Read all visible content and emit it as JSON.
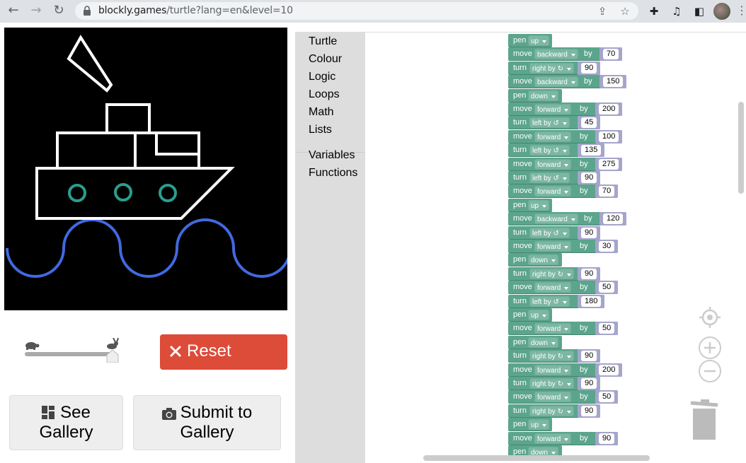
{
  "browser": {
    "url_host": "blockly.games",
    "url_path": "/turtle?lang=en&level=10"
  },
  "speed": {
    "value": 1.0
  },
  "buttons": {
    "reset": "Reset",
    "see_gallery_line1": "See",
    "see_gallery_line2": "Gallery",
    "submit_line1": "Submit to",
    "submit_line2": "Gallery"
  },
  "toolbox": {
    "categories": [
      "Turtle",
      "Colour",
      "Logic",
      "Loops",
      "Math",
      "Lists"
    ],
    "categories2": [
      "Variables",
      "Functions"
    ]
  },
  "colors": {
    "block": "#5ba58c",
    "math_block": "#a5a5cc",
    "reset": "#dd4b39",
    "wave": "#4169e1",
    "portholes": "#2a9d8f"
  },
  "program": [
    {
      "type": "pen",
      "kw": "pen",
      "opt": "up"
    },
    {
      "type": "move",
      "kw": "move",
      "opt": "backward",
      "by": "by",
      "val": "70"
    },
    {
      "type": "turn",
      "kw": "turn",
      "opt": "right by ↻",
      "val": "90"
    },
    {
      "type": "move",
      "kw": "move",
      "opt": "backward",
      "by": "by",
      "val": "150"
    },
    {
      "type": "pen",
      "kw": "pen",
      "opt": "down"
    },
    {
      "type": "move",
      "kw": "move",
      "opt": "forward",
      "by": "by",
      "val": "200"
    },
    {
      "type": "turn",
      "kw": "turn",
      "opt": "left by ↺",
      "val": "45"
    },
    {
      "type": "move",
      "kw": "move",
      "opt": "forward",
      "by": "by",
      "val": "100"
    },
    {
      "type": "turn",
      "kw": "turn",
      "opt": "left by ↺",
      "val": "135"
    },
    {
      "type": "move",
      "kw": "move",
      "opt": "forward",
      "by": "by",
      "val": "275"
    },
    {
      "type": "turn",
      "kw": "turn",
      "opt": "left by ↺",
      "val": "90"
    },
    {
      "type": "move",
      "kw": "move",
      "opt": "forward",
      "by": "by",
      "val": "70"
    },
    {
      "type": "pen",
      "kw": "pen",
      "opt": "up"
    },
    {
      "type": "move",
      "kw": "move",
      "opt": "backward",
      "by": "by",
      "val": "120"
    },
    {
      "type": "turn",
      "kw": "turn",
      "opt": "left by ↺",
      "val": "90"
    },
    {
      "type": "move",
      "kw": "move",
      "opt": "forward",
      "by": "by",
      "val": "30"
    },
    {
      "type": "pen",
      "kw": "pen",
      "opt": "down"
    },
    {
      "type": "turn",
      "kw": "turn",
      "opt": "right by ↻",
      "val": "90"
    },
    {
      "type": "move",
      "kw": "move",
      "opt": "forward",
      "by": "by",
      "val": "50"
    },
    {
      "type": "turn",
      "kw": "turn",
      "opt": "left by ↺",
      "val": "180"
    },
    {
      "type": "pen",
      "kw": "pen",
      "opt": "up"
    },
    {
      "type": "move",
      "kw": "move",
      "opt": "forward",
      "by": "by",
      "val": "50"
    },
    {
      "type": "pen",
      "kw": "pen",
      "opt": "down"
    },
    {
      "type": "turn",
      "kw": "turn",
      "opt": "right by ↻",
      "val": "90"
    },
    {
      "type": "move",
      "kw": "move",
      "opt": "forward",
      "by": "by",
      "val": "200"
    },
    {
      "type": "turn",
      "kw": "turn",
      "opt": "right by ↻",
      "val": "90"
    },
    {
      "type": "move",
      "kw": "move",
      "opt": "forward",
      "by": "by",
      "val": "50"
    },
    {
      "type": "turn",
      "kw": "turn",
      "opt": "right by ↻",
      "val": "90"
    },
    {
      "type": "pen",
      "kw": "pen",
      "opt": "up"
    },
    {
      "type": "move",
      "kw": "move",
      "opt": "forward",
      "by": "by",
      "val": "90"
    },
    {
      "type": "pen",
      "kw": "pen",
      "opt": "down"
    }
  ]
}
